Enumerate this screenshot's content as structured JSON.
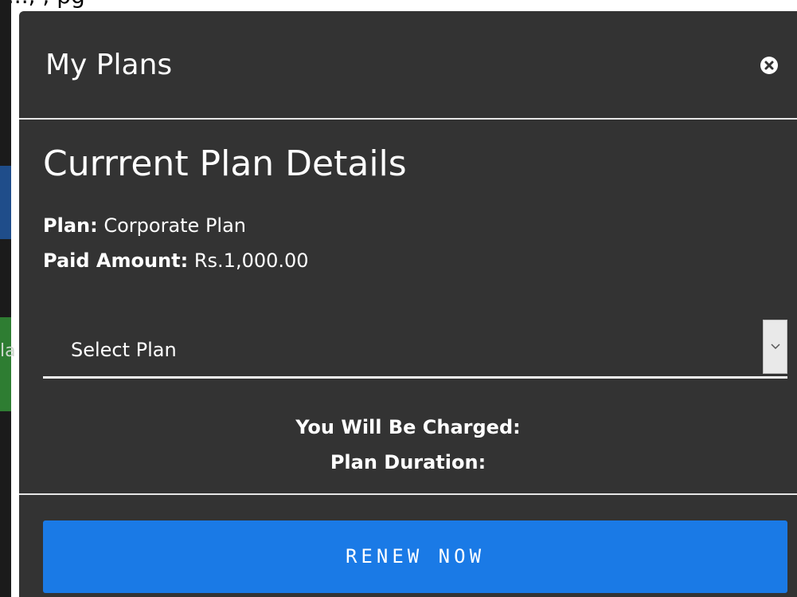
{
  "background": {
    "top_fragment_text": "...., , pg",
    "left_fragment_text": "la"
  },
  "modal": {
    "title": "My Plans",
    "close_icon": "close-circle-icon",
    "section_title": "Currrent Plan Details",
    "plan_label": "Plan:",
    "plan_value": "Corporate Plan",
    "paid_label": "Paid Amount:",
    "paid_value": "Rs.1,000.00",
    "select": {
      "selected": "Select Plan",
      "arrow_icon": "chevron-down-icon"
    },
    "charged_label": "You Will Be Charged:",
    "duration_label": "Plan Duration:",
    "renew_button": "RENEW NOW"
  },
  "colors": {
    "modal_bg": "#333333",
    "button_blue": "#1a7ae6",
    "divider": "#e6e6e6"
  }
}
